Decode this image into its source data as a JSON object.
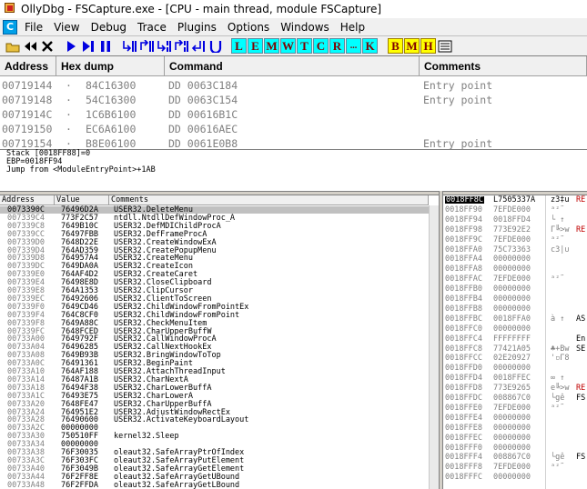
{
  "window": {
    "title": "OllyDbg - FSCapture.exe - [CPU - main thread, module FSCapture]"
  },
  "menu": {
    "cpu_icon": "C",
    "items": [
      "File",
      "View",
      "Debug",
      "Trace",
      "Plugins",
      "Options",
      "Windows",
      "Help"
    ]
  },
  "toolbar": {
    "icons": [
      "open-icon",
      "rewind-icon",
      "close-icon",
      "run-icon",
      "step-icon",
      "pause-icon",
      "step-into-icon",
      "step-over-icon",
      "trace-into-icon",
      "trace-over-icon",
      "execute-till-return-icon",
      "goto-icon"
    ],
    "letters": [
      "L",
      "E",
      "M",
      "W",
      "T",
      "C",
      "R",
      "...",
      "K"
    ],
    "letters2": [
      "B",
      "M",
      "H"
    ]
  },
  "disasm": {
    "headers": {
      "address": "Address",
      "hex": "Hex dump",
      "command": "Command",
      "comments": "Comments"
    },
    "rows": [
      {
        "address": "00719144",
        "dot": "·",
        "hex": "84C16300",
        "command": "DD 0063C184",
        "comment": "Entry point"
      },
      {
        "address": "00719148",
        "dot": "·",
        "hex": "54C16300",
        "command": "DD 0063C154",
        "comment": "Entry point"
      },
      {
        "address": "0071914C",
        "dot": "·",
        "hex": "1C6B6100",
        "command": "DD 00616B1C",
        "comment": ""
      },
      {
        "address": "00719150",
        "dot": "·",
        "hex": "EC6A6100",
        "command": "DD 00616AEC",
        "comment": ""
      },
      {
        "address": "00719154",
        "dot": "·",
        "hex": "B8E06100",
        "command": "DD 0061E0B8",
        "comment": "Entry point"
      }
    ]
  },
  "info": {
    "lines": [
      "Stack [0018FF88]=0",
      "EBP=0018FF94",
      "Jump from <ModuleEntryPoint>+1AB"
    ]
  },
  "dump": {
    "headers": {
      "address": "Address",
      "value": "Value",
      "comments": "Comments"
    },
    "rows": [
      {
        "address": "0073390C",
        "value": "76496D2A",
        "comment": "USER32.DeleteMenu"
      },
      {
        "address": "007339C4",
        "value": "773F2C57",
        "comment": "ntdll.NtdllDefWindowProc_A"
      },
      {
        "address": "007339C8",
        "value": "7649B10C",
        "comment": "USER32.DefMDIChildProcA"
      },
      {
        "address": "007339CC",
        "value": "76497FBB",
        "comment": "USER32.DefFrameProcA"
      },
      {
        "address": "007339D0",
        "value": "7648D22E",
        "comment": "USER32.CreateWindowExA"
      },
      {
        "address": "007339D4",
        "value": "764AD359",
        "comment": "USER32.CreatePopupMenu"
      },
      {
        "address": "007339D8",
        "value": "764957A4",
        "comment": "USER32.CreateMenu"
      },
      {
        "address": "007339DC",
        "value": "7649DA0A",
        "comment": "USER32.CreateIcon"
      },
      {
        "address": "007339E0",
        "value": "764AF4D2",
        "comment": "USER32.CreateCaret"
      },
      {
        "address": "007339E4",
        "value": "76498E8D",
        "comment": "USER32.CloseClipboard"
      },
      {
        "address": "007339E8",
        "value": "764A1353",
        "comment": "USER32.ClipCursor"
      },
      {
        "address": "007339EC",
        "value": "76492606",
        "comment": "USER32.ClientToScreen"
      },
      {
        "address": "007339F0",
        "value": "7649CD46",
        "comment": "USER32.ChildWindowFromPointEx"
      },
      {
        "address": "007339F4",
        "value": "764C8CF0",
        "comment": "USER32.ChildWindowFromPoint"
      },
      {
        "address": "007339F8",
        "value": "7649A88C",
        "comment": "USER32.CheckMenuItem"
      },
      {
        "address": "007339FC",
        "value": "7648FCED",
        "comment": "USER32.CharUpperBuffW"
      },
      {
        "address": "00733A00",
        "value": "7649792F",
        "comment": "USER32.CallWindowProcA"
      },
      {
        "address": "00733A04",
        "value": "76496285",
        "comment": "USER32.CallNextHookEx"
      },
      {
        "address": "00733A08",
        "value": "7649B93B",
        "comment": "USER32.BringWindowToTop"
      },
      {
        "address": "00733A0C",
        "value": "76491361",
        "comment": "USER32.BeginPaint"
      },
      {
        "address": "00733A10",
        "value": "764AF188",
        "comment": "USER32.AttachThreadInput"
      },
      {
        "address": "00733A14",
        "value": "76487A1B",
        "comment": "USER32.CharNextA"
      },
      {
        "address": "00733A18",
        "value": "76494F38",
        "comment": "USER32.CharLowerBuffA"
      },
      {
        "address": "00733A1C",
        "value": "76493E75",
        "comment": "USER32.CharLowerA"
      },
      {
        "address": "00733A20",
        "value": "7648FE47",
        "comment": "USER32.CharUpperBuffA"
      },
      {
        "address": "00733A24",
        "value": "764951E2",
        "comment": "USER32.AdjustWindowRectEx"
      },
      {
        "address": "00733A28",
        "value": "76490600",
        "comment": "USER32.ActivateKeyboardLayout"
      },
      {
        "address": "00733A2C",
        "value": "00000000",
        "comment": ""
      },
      {
        "address": "00733A30",
        "value": "750510FF",
        "comment": "kernel32.Sleep"
      },
      {
        "address": "00733A34",
        "value": "00000000",
        "comment": ""
      },
      {
        "address": "00733A38",
        "value": "76F30035",
        "comment": "oleaut32.SafeArrayPtrOfIndex"
      },
      {
        "address": "00733A3C",
        "value": "76F303FC",
        "comment": "oleaut32.SafeArrayPutElement"
      },
      {
        "address": "00733A40",
        "value": "76F3049B",
        "comment": "oleaut32.SafeArrayGetElement"
      },
      {
        "address": "00733A44",
        "value": "76F2FF8E",
        "comment": "oleaut32.SafeArrayGetUBound"
      },
      {
        "address": "00733A48",
        "value": "76F2FFDA",
        "comment": "oleaut32.SafeArrayGetLBound"
      }
    ]
  },
  "stack": {
    "rows": [
      {
        "address": "0018FF8C",
        "value": "L7505337A",
        "chars": "z3‡u",
        "tag": "RE"
      },
      {
        "address": "0018FF90",
        "value": "7EFDE000",
        "chars": "ᵃᶻ˜",
        "tag": ""
      },
      {
        "address": "0018FF94",
        "value": "0018FFD4",
        "chars": "└ ↑",
        "tag": ""
      },
      {
        "address": "0018FF98",
        "value": "773E92E2",
        "chars": "Γ╚>w",
        "tag": "RE"
      },
      {
        "address": "0018FF9C",
        "value": "7EFDE000",
        "chars": "ᵃᶻ˜",
        "tag": ""
      },
      {
        "address": "0018FFA0",
        "value": "75C73363",
        "chars": "c3|∪",
        "tag": ""
      },
      {
        "address": "0018FFA4",
        "value": "00000000",
        "chars": "",
        "tag": ""
      },
      {
        "address": "0018FFA8",
        "value": "00000000",
        "chars": "",
        "tag": ""
      },
      {
        "address": "0018FFAC",
        "value": "7EFDE000",
        "chars": "ᵃᶻ˜",
        "tag": ""
      },
      {
        "address": "0018FFB0",
        "value": "00000000",
        "chars": "",
        "tag": ""
      },
      {
        "address": "0018FFB4",
        "value": "00000000",
        "chars": "",
        "tag": ""
      },
      {
        "address": "0018FFB8",
        "value": "00000000",
        "chars": "",
        "tag": ""
      },
      {
        "address": "0018FFBC",
        "value": "0018FFA0",
        "chars": "à ↑",
        "tag": "AS"
      },
      {
        "address": "0018FFC0",
        "value": "00000000",
        "chars": "",
        "tag": ""
      },
      {
        "address": "0018FFC4",
        "value": "FFFFFFFF",
        "chars": "",
        "tag": "En"
      },
      {
        "address": "0018FFC8",
        "value": "77421A05",
        "chars": "♣+Bw",
        "tag": "SE"
      },
      {
        "address": "0018FFCC",
        "value": "02E20927",
        "chars": "'▫Γ8",
        "tag": ""
      },
      {
        "address": "0018FFD0",
        "value": "00000000",
        "chars": "",
        "tag": ""
      },
      {
        "address": "0018FFD4",
        "value": "0018FFEC",
        "chars": "∞ ↑",
        "tag": ""
      },
      {
        "address": "0018FFD8",
        "value": "773E9265",
        "chars": "e╚>w",
        "tag": "RE"
      },
      {
        "address": "0018FFDC",
        "value": "008867C0",
        "chars": "└gê",
        "tag": "FS"
      },
      {
        "address": "0018FFE0",
        "value": "7EFDE000",
        "chars": "ᵃᶻ˜",
        "tag": ""
      },
      {
        "address": "0018FFE4",
        "value": "00000000",
        "chars": "",
        "tag": ""
      },
      {
        "address": "0018FFE8",
        "value": "00000000",
        "chars": "",
        "tag": ""
      },
      {
        "address": "0018FFEC",
        "value": "00000000",
        "chars": "",
        "tag": ""
      },
      {
        "address": "0018FFF0",
        "value": "00000000",
        "chars": "",
        "tag": ""
      },
      {
        "address": "0018FFF4",
        "value": "008867C0",
        "chars": "└gê",
        "tag": "FS"
      },
      {
        "address": "0018FFF8",
        "value": "7EFDE000",
        "chars": "ᵃᶻ˜",
        "tag": ""
      },
      {
        "address": "0018FFFC",
        "value": "00000000",
        "chars": "",
        "tag": ""
      }
    ]
  }
}
